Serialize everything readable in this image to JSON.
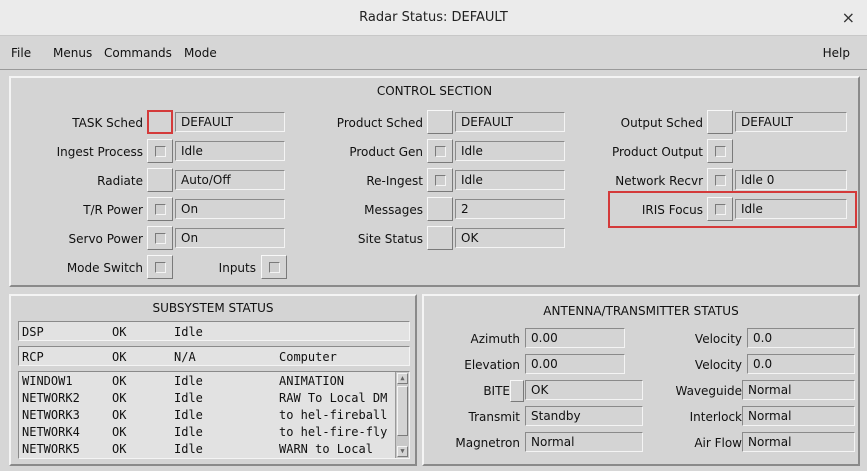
{
  "window": {
    "title": "Radar Status: DEFAULT",
    "close_glyph": "×"
  },
  "menu": {
    "file": "File",
    "menus": "Menus",
    "commands": "Commands",
    "mode": "Mode",
    "help": "Help"
  },
  "control": {
    "title": "CONTROL SECTION",
    "task_sched": {
      "label": "TASK Sched",
      "value": "DEFAULT"
    },
    "ingest_process": {
      "label": "Ingest Process",
      "value": "Idle"
    },
    "radiate": {
      "label": "Radiate",
      "value": "Auto/Off"
    },
    "tr_power": {
      "label": "T/R Power",
      "value": "On"
    },
    "servo_power": {
      "label": "Servo Power",
      "value": "On"
    },
    "mode_switch": {
      "label": "Mode Switch"
    },
    "inputs": {
      "label": "Inputs"
    },
    "product_sched": {
      "label": "Product Sched",
      "value": "DEFAULT"
    },
    "product_gen": {
      "label": "Product Gen",
      "value": "Idle"
    },
    "re_ingest": {
      "label": "Re-Ingest",
      "value": "Idle"
    },
    "messages": {
      "label": "Messages",
      "value": "2"
    },
    "site_status": {
      "label": "Site Status",
      "value": "OK"
    },
    "output_sched": {
      "label": "Output Sched",
      "value": "DEFAULT"
    },
    "product_output": {
      "label": "Product Output"
    },
    "network_recvr": {
      "label": "Network Recvr",
      "value": "Idle  0"
    },
    "iris_focus": {
      "label": "IRIS Focus",
      "value": "Idle"
    }
  },
  "subsystem": {
    "title": "SUBSYSTEM STATUS",
    "dsp": {
      "name": "DSP",
      "status": "OK",
      "state": "Idle",
      "note": ""
    },
    "rcp": {
      "name": "RCP",
      "status": "OK",
      "state": "N/A",
      "note": "Computer"
    },
    "rows": [
      {
        "name": "WINDOW1",
        "status": "OK",
        "state": "Idle",
        "note": "ANIMATION"
      },
      {
        "name": "NETWORK2",
        "status": "OK",
        "state": "Idle",
        "note": "RAW To Local DM"
      },
      {
        "name": "NETWORK3",
        "status": "OK",
        "state": "Idle",
        "note": "to hel-fireball"
      },
      {
        "name": "NETWORK4",
        "status": "OK",
        "state": "Idle",
        "note": "to hel-fire-fly"
      },
      {
        "name": "NETWORK5",
        "status": "OK",
        "state": "Idle",
        "note": "WARN to Local"
      }
    ]
  },
  "antenna": {
    "title": "ANTENNA/TRANSMITTER STATUS",
    "azimuth": {
      "label": "Azimuth",
      "value": "0.00"
    },
    "elevation": {
      "label": "Elevation",
      "value": "0.00"
    },
    "bite": {
      "label": "BITE",
      "value": "OK"
    },
    "transmit": {
      "label": "Transmit",
      "value": "Standby"
    },
    "magnetron": {
      "label": "Magnetron",
      "value": "Normal"
    },
    "velocity1": {
      "label": "Velocity",
      "value": "0.0"
    },
    "velocity2": {
      "label": "Velocity",
      "value": "0.0"
    },
    "waveguide": {
      "label": "Waveguide",
      "value": "Normal"
    },
    "interlock": {
      "label": "Interlock",
      "value": "Normal"
    },
    "airflow": {
      "label": "Air Flow",
      "value": "Normal"
    }
  },
  "colors": {
    "highlight": "#d43a3a",
    "background": "#d6d6d6"
  }
}
